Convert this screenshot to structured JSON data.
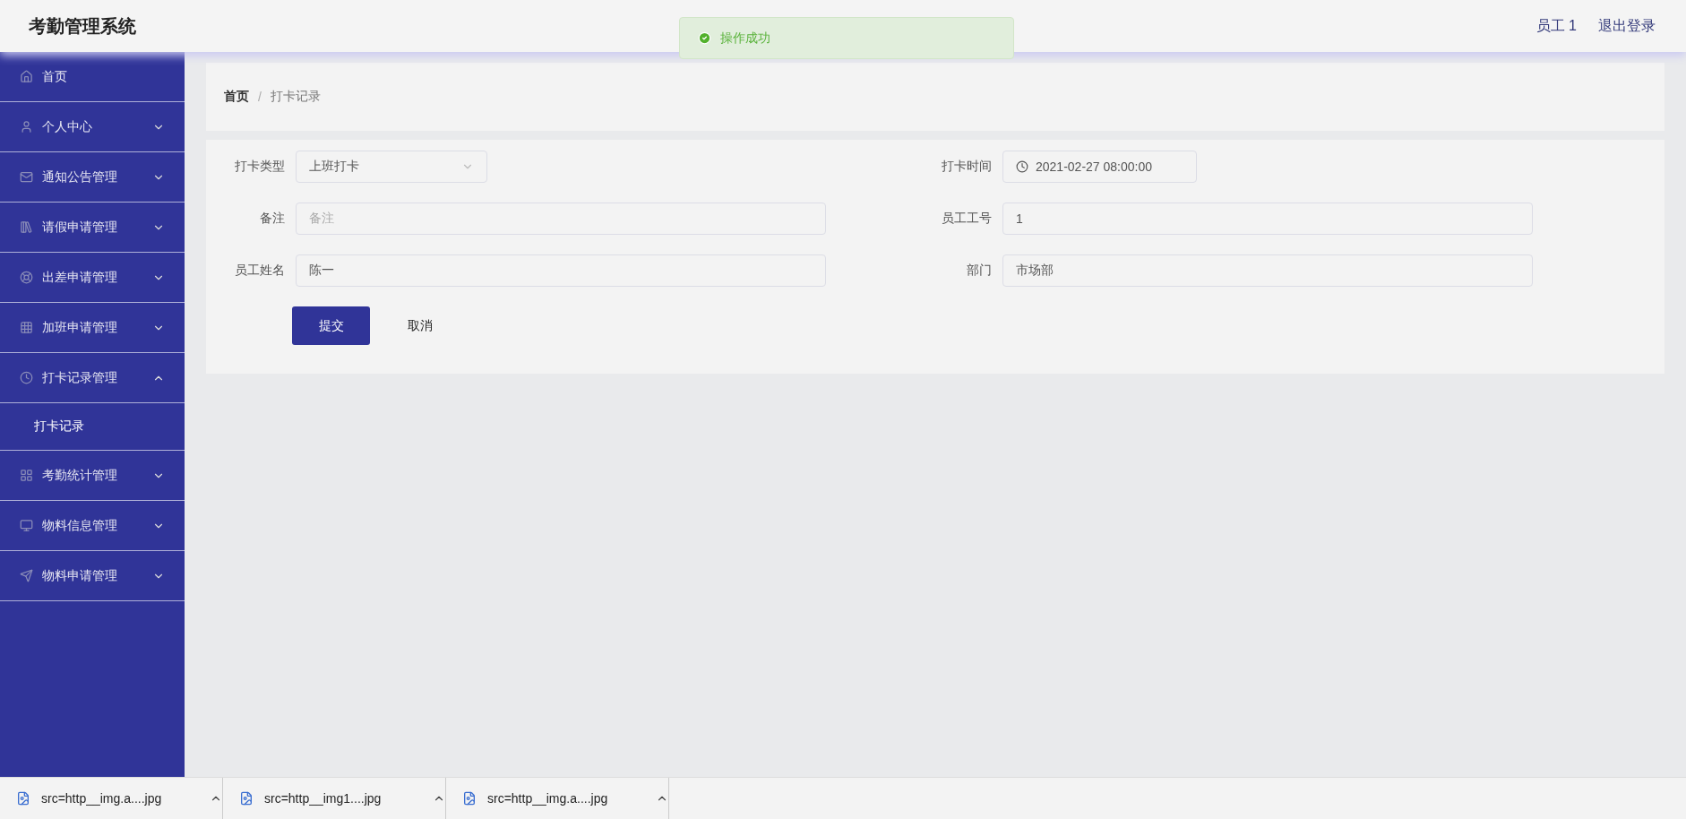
{
  "app_title": "考勤管理系统",
  "user": {
    "name": "员工 1",
    "logout": "退出登录"
  },
  "toast": {
    "kind": "success",
    "text": "操作成功"
  },
  "sidebar": {
    "items": [
      {
        "label": "首页",
        "kind": "link"
      },
      {
        "label": "个人中心",
        "kind": "submenu",
        "expanded": false
      },
      {
        "label": "通知公告管理",
        "kind": "submenu",
        "expanded": false
      },
      {
        "label": "请假申请管理",
        "kind": "submenu",
        "expanded": false
      },
      {
        "label": "出差申请管理",
        "kind": "submenu",
        "expanded": false
      },
      {
        "label": "加班申请管理",
        "kind": "submenu",
        "expanded": false
      },
      {
        "label": "打卡记录管理",
        "kind": "submenu",
        "expanded": true,
        "children": [
          {
            "label": "打卡记录"
          }
        ]
      },
      {
        "label": "考勤统计管理",
        "kind": "submenu",
        "expanded": false
      },
      {
        "label": "物料信息管理",
        "kind": "submenu",
        "expanded": false
      },
      {
        "label": "物料申请管理",
        "kind": "submenu",
        "expanded": false
      }
    ]
  },
  "breadcrumb": {
    "separator": "/",
    "items": [
      "首页",
      "打卡记录"
    ]
  },
  "form": {
    "fields": [
      {
        "label": "打卡类型",
        "kind": "select",
        "value": "上班打卡"
      },
      {
        "label": "打卡时间",
        "kind": "date",
        "value": "2021-02-27 08:00:00"
      },
      {
        "label": "备注",
        "kind": "text",
        "placeholder": "备注"
      },
      {
        "label": "员工工号",
        "kind": "text",
        "value": "1"
      },
      {
        "label": "员工姓名",
        "kind": "text",
        "value": "陈一"
      },
      {
        "label": "部门",
        "kind": "text",
        "value": "市场部"
      }
    ],
    "buttons": [
      {
        "label": "提交",
        "kind": "primary"
      },
      {
        "label": "取消",
        "kind": "plain"
      }
    ]
  },
  "downloads": [
    {
      "name": "src=http__img.a....jpg"
    },
    {
      "name": "src=http__img1....jpg"
    },
    {
      "name": "src=http__img.a....jpg"
    }
  ]
}
